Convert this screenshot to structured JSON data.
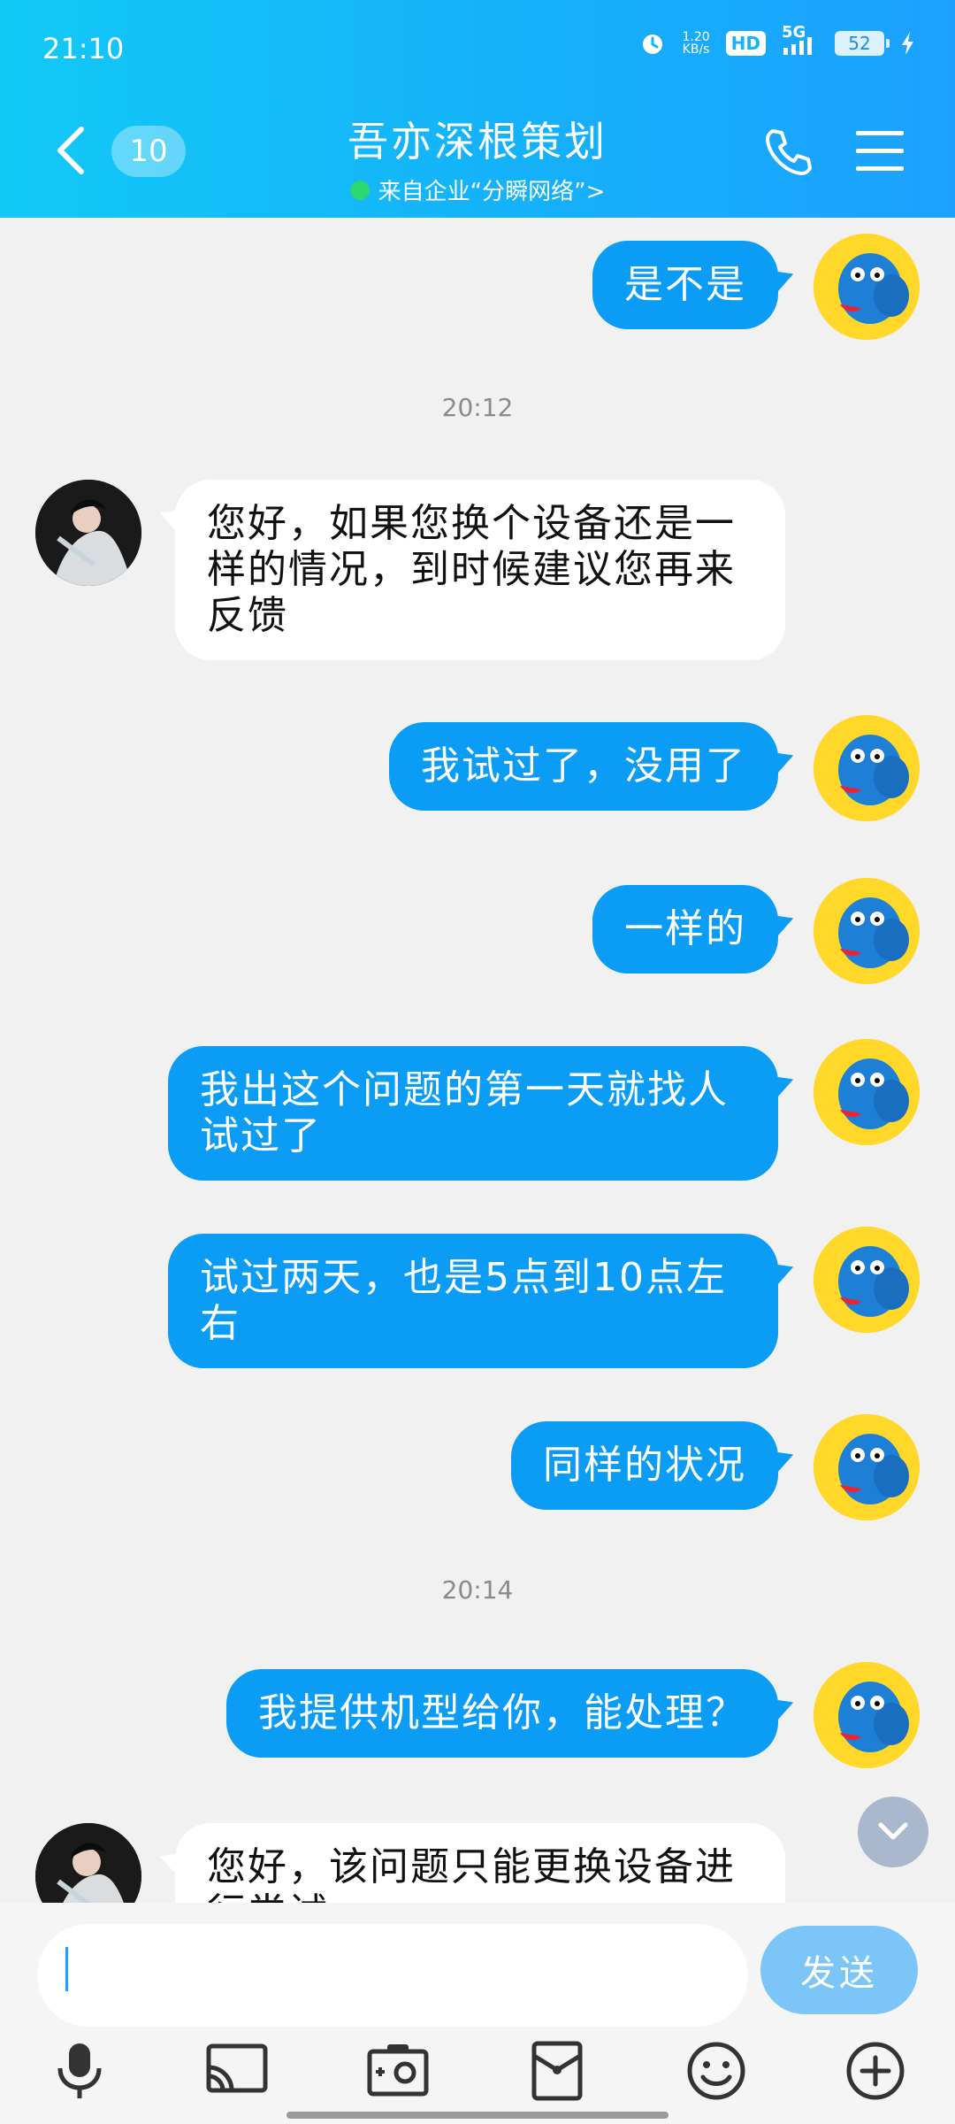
{
  "status_bar": {
    "time": "21:10",
    "net_speed_top": "1.20",
    "net_speed_bottom": "KB/s",
    "hd": "HD",
    "network": "5G",
    "battery": "52",
    "icons": [
      "alarm-icon",
      "signal-icon",
      "charging-icon"
    ]
  },
  "header": {
    "back_icon": "chevron-left-icon",
    "unread_count": "10",
    "title": "吾亦深根策划",
    "subtitle": "来自企业“分瞬网络”>",
    "call_icon": "phone-icon",
    "menu_icon": "menu-icon",
    "online_color": "#2ed573"
  },
  "messages": [
    {
      "side": "me",
      "text": "是不是"
    },
    {
      "side": "time",
      "text": "20:12"
    },
    {
      "side": "them",
      "text": "您好，如果您换个设备还是一样的情况，到时候建议您再来反馈"
    },
    {
      "side": "me",
      "text": "我试过了，没用了"
    },
    {
      "side": "me",
      "text": "一样的"
    },
    {
      "side": "me",
      "text": "我出这个问题的第一天就找人试过了"
    },
    {
      "side": "me",
      "text": " 试过两天，也是5点到10点左右"
    },
    {
      "side": "me",
      "text": "同样的状况"
    },
    {
      "side": "time",
      "text": "20:14"
    },
    {
      "side": "me",
      "text": "我提供机型给你，能处理？"
    },
    {
      "side": "them",
      "text": "您好，该问题只能更换设备进行尝试"
    }
  ],
  "input": {
    "placeholder": "",
    "value": "",
    "send_label": "发送"
  },
  "toolbar": {
    "items": [
      "microphone-icon",
      "cast-icon",
      "photo-icon",
      "red-packet-icon",
      "emoji-icon",
      "plus-icon"
    ]
  },
  "colors": {
    "header_start": "#12c9f6",
    "header_end": "#1ca1ff",
    "my_bubble": "#0b9cf5",
    "their_bubble": "#ffffff",
    "send_button": "#7cc6f7"
  }
}
